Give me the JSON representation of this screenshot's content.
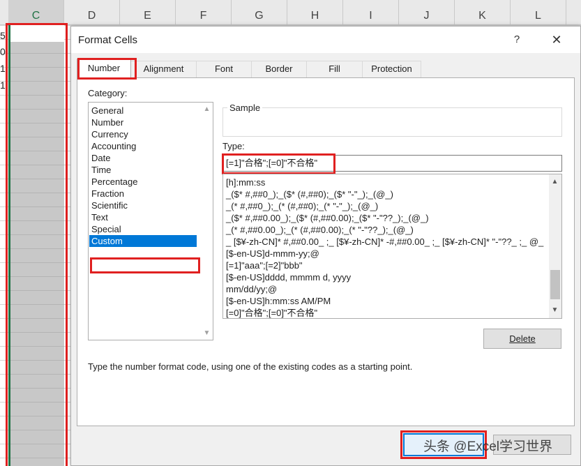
{
  "sheet": {
    "columns": [
      "C",
      "D",
      "E",
      "F",
      "G",
      "H",
      "I",
      "J",
      "K",
      "L"
    ],
    "row_values": [
      "5",
      "0",
      "1",
      "1"
    ]
  },
  "dialog": {
    "title": "Format Cells",
    "help_label": "?",
    "close_label": "✕",
    "tabs": [
      "Number",
      "Alignment",
      "Font",
      "Border",
      "Fill",
      "Protection"
    ],
    "active_tab": "Number",
    "category_label": "Category:",
    "categories": [
      "General",
      "Number",
      "Currency",
      "Accounting",
      "Date",
      "Time",
      "Percentage",
      "Fraction",
      "Scientific",
      "Text",
      "Special",
      "Custom"
    ],
    "selected_category": "Custom",
    "sample_label": "Sample",
    "type_label": "Type:",
    "type_value": "[=1]\"合格\";[=0]\"不合格\"",
    "formats": [
      "[h]:mm:ss",
      "_($* #,##0_);_($* (#,##0);_($* \"-\"_);_(@_)",
      "_(* #,##0_);_(* (#,##0);_(* \"-\"_);_(@_)",
      "_($* #,##0.00_);_($* (#,##0.00);_($* \"-\"??_);_(@_)",
      "_(* #,##0.00_);_(* (#,##0.00);_(* \"-\"??_);_(@_)",
      "_ [$¥-zh-CN]* #,##0.00_ ;_ [$¥-zh-CN]* -#,##0.00_ ;_ [$¥-zh-CN]* \"-\"??_ ;_ @_",
      "[$-en-US]d-mmm-yy;@",
      "[=1]\"aaa\";[=2]\"bbb\"",
      "[$-en-US]dddd, mmmm d, yyyy",
      "mm/dd/yy;@",
      "[$-en-US]h:mm:ss AM/PM",
      "[=0]\"合格\";[=0]\"不合格\""
    ],
    "delete_label": "Delete",
    "hint": "Type the number format code, using one of the existing codes as a starting point.",
    "ok_label": "",
    "cancel_label": "",
    "watermark": "头条 @Excel学习世界"
  },
  "colors": {
    "highlight": "#e02020",
    "selection": "#0078d7",
    "excel_green": "#217346"
  },
  "icons": {
    "scroll_up": "chevron-up-icon",
    "scroll_down": "chevron-down-icon"
  }
}
